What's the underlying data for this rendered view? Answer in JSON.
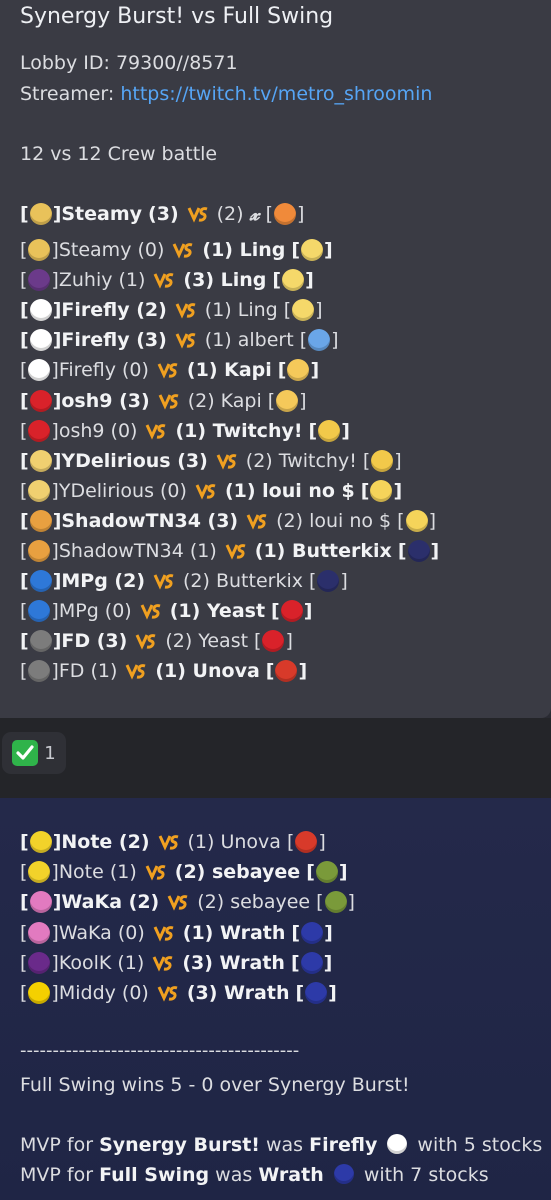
{
  "header": {
    "title": "Synergy Burst! vs Full Swing",
    "lobby_label": "Lobby ID: 79300//8571",
    "streamer_label": "Streamer: ",
    "streamer_link": "https://twitch.tv/metro_shroomin",
    "format": "12 vs 12 Crew battle"
  },
  "summary_row": {
    "left_name": "Steamy",
    "left_score": "(3)",
    "right_score": "(2)",
    "right_text": "𝔁",
    "bold_left": true
  },
  "matches_part1": [
    {
      "left": "Steamy (0)",
      "right": "(1) Ling",
      "win": "right",
      "licon": "#e9c25a",
      "ricon": "#f5d86a"
    },
    {
      "left": "Zuhiy (1)",
      "right": "(3) Ling",
      "win": "right",
      "licon": "#6b3a8a",
      "ricon": "#f5d86a"
    },
    {
      "left": "Firefly (2)",
      "right": "(1) Ling",
      "win": "left",
      "licon": "#ffffff",
      "ricon": "#f5d86a"
    },
    {
      "left": "Firefly (3)",
      "right": "(1) albert",
      "win": "left",
      "licon": "#ffffff",
      "ricon": "#6aa6e8"
    },
    {
      "left": "Firefly (0)",
      "right": "(1) Kapi",
      "win": "right",
      "licon": "#ffffff",
      "ricon": "#f5c95a"
    },
    {
      "left": "osh9 (3)",
      "right": "(2) Kapi",
      "win": "left",
      "licon": "#d9222a",
      "ricon": "#f5c95a"
    },
    {
      "left": "osh9 (0)",
      "right": "(1) Twitchy!",
      "win": "right",
      "licon": "#d9222a",
      "ricon": "#f2c94a"
    },
    {
      "left": "YDelirious (3)",
      "right": "(2) Twitchy!",
      "win": "left",
      "licon": "#f0d070",
      "ricon": "#f2c94a"
    },
    {
      "left": "YDelirious (0)",
      "right": "(1) loui no $",
      "win": "right",
      "licon": "#f0d070",
      "ricon": "#f5d45a"
    },
    {
      "left": "ShadowTN34 (3)",
      "right": "(2) loui no $",
      "win": "left",
      "licon": "#e8a040",
      "ricon": "#f5d45a"
    },
    {
      "left": "ShadowTN34 (1)",
      "right": "(1) Butterkix",
      "win": "right",
      "licon": "#e8a040",
      "ricon": "#2b2f6b"
    },
    {
      "left": "MPg (2)",
      "right": "(2) Butterkix",
      "win": "left",
      "licon": "#2e78d8",
      "ricon": "#2b2f6b"
    },
    {
      "left": "MPg (0)",
      "right": "(1) Yeast",
      "win": "right",
      "licon": "#2e78d8",
      "ricon": "#d9222a"
    },
    {
      "left": "FD (3)",
      "right": "(2) Yeast",
      "win": "left",
      "licon": "#7c7c7c",
      "ricon": "#d9222a"
    },
    {
      "left": "FD (1)",
      "right": "(1) Unova",
      "win": "right",
      "licon": "#7c7c7c",
      "ricon": "#d83a2a"
    }
  ],
  "reaction": {
    "emoji": "check-mark",
    "count": "1"
  },
  "matches_part2": [
    {
      "left": "Note (2)",
      "right": "(1) Unova",
      "win": "left",
      "licon": "#f2d22a",
      "ricon": "#d83a2a"
    },
    {
      "left": "Note (1)",
      "right": "(2) sebayee",
      "win": "right",
      "licon": "#f2d22a",
      "ricon": "#7a9a3a"
    },
    {
      "left": "WaKa (2)",
      "right": "(2) sebayee",
      "win": "left",
      "licon": "#e27ac0",
      "ricon": "#7a9a3a"
    },
    {
      "left": "WaKa (0)",
      "right": "(1) Wrath",
      "win": "right",
      "licon": "#e27ac0",
      "ricon": "#2d3aa8"
    },
    {
      "left": "KoolK (1)",
      "right": "(3) Wrath",
      "win": "right",
      "licon": "#6a2a8a",
      "ricon": "#2d3aa8"
    },
    {
      "left": "Middy (0)",
      "right": "(3) Wrath",
      "win": "right",
      "licon": "#f4d000",
      "ricon": "#2d3aa8"
    }
  ],
  "footer": {
    "separator": "-------------------------------------------",
    "result": "Full Swing wins 5 - 0 over Synergy Burst!",
    "mvp1_pre": "MVP for ",
    "mvp1_team": "Synergy Burst!",
    "mvp1_mid": " was ",
    "mvp1_player": "Firefly",
    "mvp1_post": " with 5 stocks",
    "mvp2_pre": "MVP for ",
    "mvp2_team": "Full Swing",
    "mvp2_mid": " was ",
    "mvp2_player": "Wrath",
    "mvp2_post": " with 7 stocks"
  }
}
